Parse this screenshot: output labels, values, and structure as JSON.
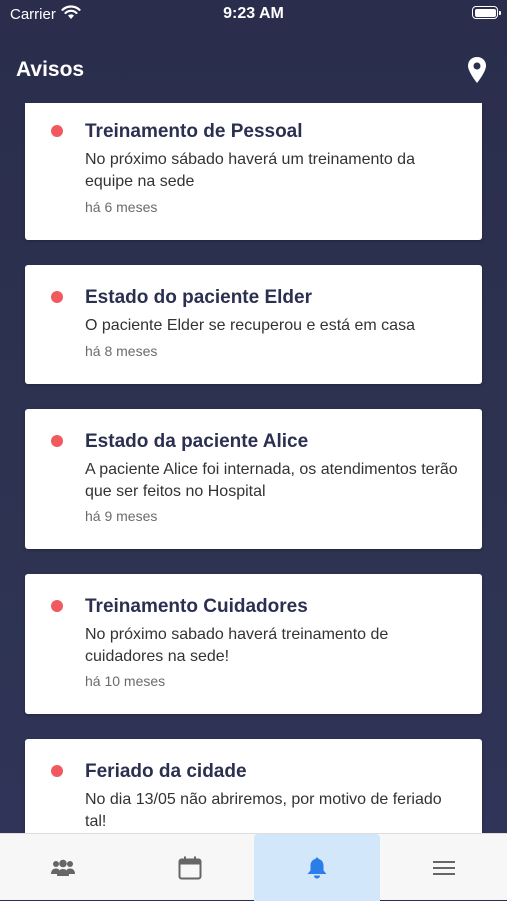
{
  "status_bar": {
    "carrier": "Carrier",
    "time": "9:23 AM"
  },
  "header": {
    "title": "Avisos",
    "location_icon": "location-pin-icon"
  },
  "notices": [
    {
      "title": "Treinamento de Pessoal",
      "body": "No próximo sábado haverá um treinamento da equipe na sede",
      "time": "há 6 meses",
      "unread": true
    },
    {
      "title": "Estado do paciente Elder",
      "body": "O paciente Elder se recuperou e está em casa",
      "time": "há 8 meses",
      "unread": true
    },
    {
      "title": "Estado da paciente Alice",
      "body": "A paciente Alice foi internada, os atendimentos terão que ser feitos no Hospital",
      "time": "há 9 meses",
      "unread": true
    },
    {
      "title": "Treinamento Cuidadores",
      "body": "No próximo sabado haverá treinamento de cuidadores na sede!",
      "time": "há 10 meses",
      "unread": true
    },
    {
      "title": "Feriado da cidade",
      "body": "No dia 13/05 não abriremos, por motivo de feriado tal!",
      "time": "",
      "unread": true
    }
  ],
  "tab_bar": {
    "tabs": [
      {
        "icon": "users-icon",
        "active": false
      },
      {
        "icon": "calendar-icon",
        "active": false
      },
      {
        "icon": "bell-icon",
        "active": true
      },
      {
        "icon": "menu-icon",
        "active": false
      }
    ]
  },
  "colors": {
    "background": "#2c3050",
    "unread_dot": "#f05a5f",
    "active_tab": "#d3e7fb",
    "accent": "#2b7de9"
  }
}
